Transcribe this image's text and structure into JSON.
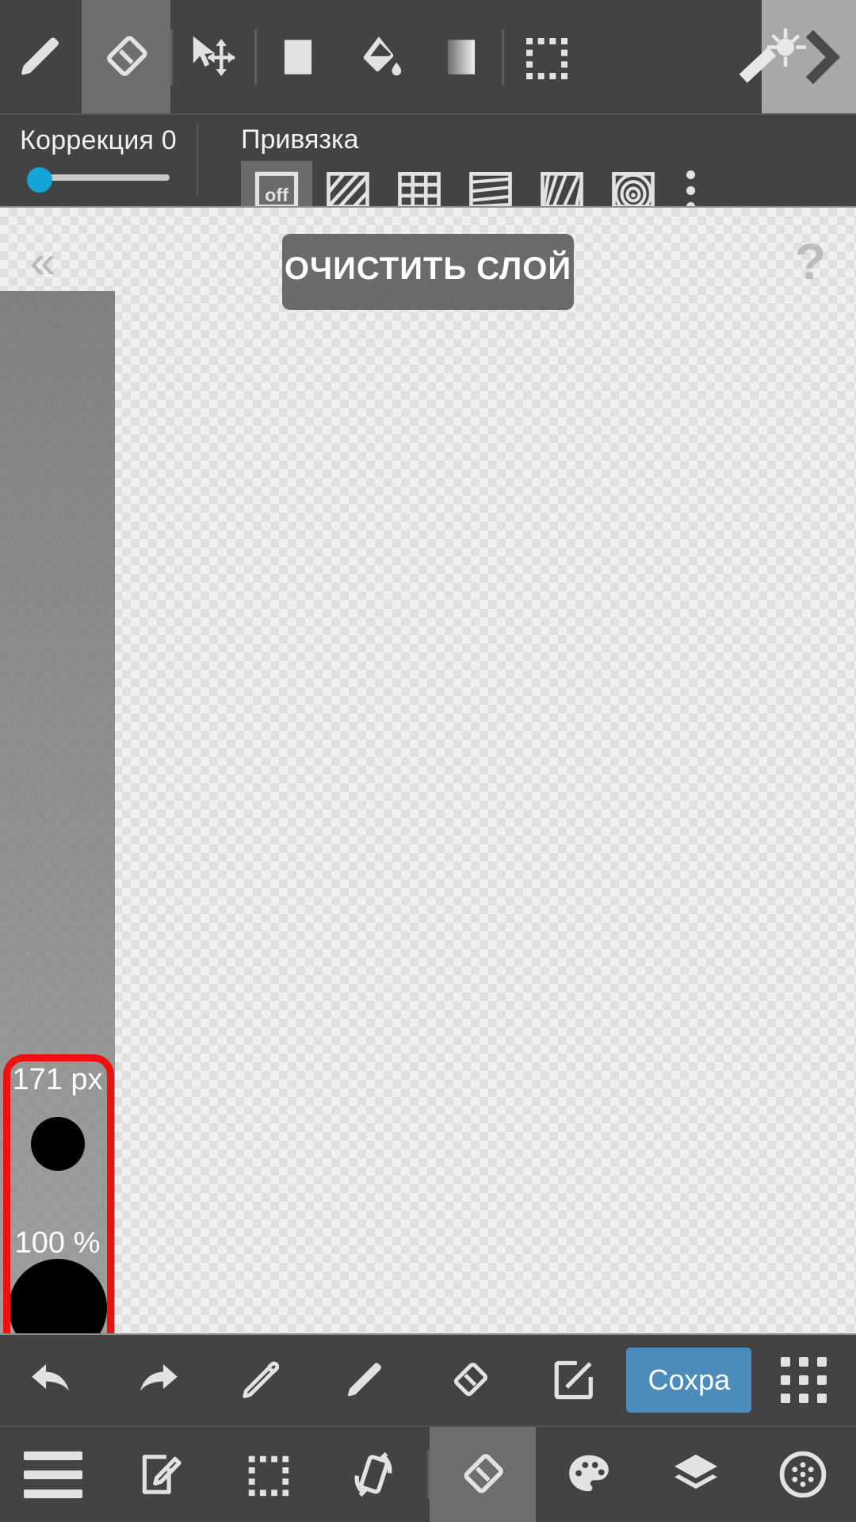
{
  "top_toolbar": {
    "tools": [
      {
        "name": "pencil-tool",
        "label": "Карандаш",
        "active": false
      },
      {
        "name": "eraser-tool",
        "label": "Ластик",
        "active": true
      },
      {
        "name": "move-select-tool",
        "label": "Перемещение",
        "active": false
      },
      {
        "name": "fill-shape-tool",
        "label": "Фигура",
        "active": false
      },
      {
        "name": "bucket-fill-tool",
        "label": "Заливка",
        "active": false
      },
      {
        "name": "gradient-tool",
        "label": "Градиент",
        "active": false
      },
      {
        "name": "marquee-select-tool",
        "label": "Выделение",
        "active": false
      },
      {
        "name": "magic-wand-tool",
        "label": "Волшебная палочка",
        "active": false
      }
    ],
    "expand_label": "›"
  },
  "settings": {
    "correction": {
      "label": "Коррекция 0",
      "value": 0,
      "slider_percent": 0,
      "knob_color": "#14a5d6"
    },
    "snap": {
      "label": "Привязка",
      "options": [
        {
          "name": "snap-off",
          "label": "off",
          "active": true
        },
        {
          "name": "snap-parallel-lines",
          "label": "Параллельные",
          "active": false
        },
        {
          "name": "snap-grid",
          "label": "Сетка",
          "active": false
        },
        {
          "name": "snap-perspective-1pt",
          "label": "Перспектива 1",
          "active": false
        },
        {
          "name": "snap-perspective-radial",
          "label": "Перспектива 2",
          "active": false
        },
        {
          "name": "snap-concentric",
          "label": "Концентрическая",
          "active": false
        }
      ],
      "more_label": "Ещё"
    }
  },
  "canvas": {
    "back_chevron": "«",
    "help_glyph": "?",
    "toast": "ОЧИСТИТЬ СЛОЙ",
    "brush_preview": {
      "size_label": "171 px",
      "opacity_label": "100 %",
      "highlight_color": "#f01010"
    }
  },
  "action_bar": {
    "items": [
      {
        "name": "undo-button",
        "label": "Отменить"
      },
      {
        "name": "redo-button",
        "label": "Повторить"
      },
      {
        "name": "eyedropper-button",
        "label": "Пипетка"
      },
      {
        "name": "pencil-button",
        "label": "Карандаш"
      },
      {
        "name": "eraser-button",
        "label": "Ластик"
      },
      {
        "name": "share-button",
        "label": "Поделиться"
      }
    ],
    "save_label": "Сохра",
    "apps_label": "Меню"
  },
  "bottom_nav": {
    "items": [
      {
        "name": "menu-button",
        "label": "Меню",
        "active": false
      },
      {
        "name": "new-canvas-button",
        "label": "Новый",
        "active": false
      },
      {
        "name": "select-button",
        "label": "Выделить",
        "active": false
      },
      {
        "name": "rotate-button",
        "label": "Поворот",
        "active": false
      },
      {
        "name": "eraser-nav-button",
        "label": "Ластик",
        "active": true
      },
      {
        "name": "palette-button",
        "label": "Палитра",
        "active": false
      },
      {
        "name": "layers-button",
        "label": "Слои",
        "active": false
      },
      {
        "name": "brush-settings-button",
        "label": "Кисть",
        "active": false
      }
    ]
  }
}
